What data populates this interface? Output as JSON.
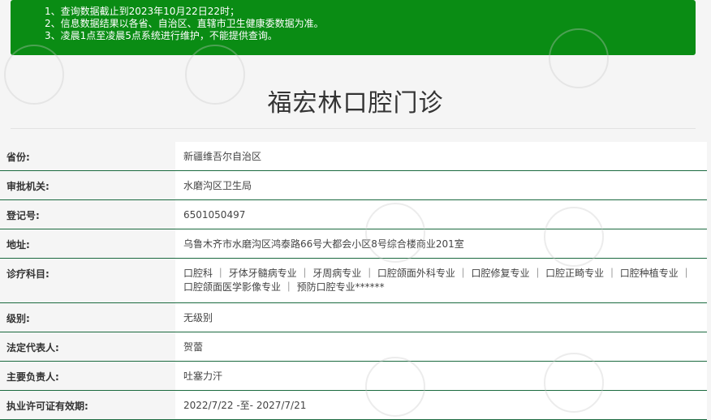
{
  "notice": {
    "lines": [
      "1、查询数据截止到2023年10月22日22时；",
      "2、信息数据结果以各省、自治区、直辖市卫生健康委数据为准。",
      "3、凌晨1点至凌晨5点系统进行维护，不能提供查询。"
    ]
  },
  "title": "福宏林口腔门诊",
  "rows": [
    {
      "label": "省份:",
      "value": "新疆维吾尔自治区"
    },
    {
      "label": "审批机关:",
      "value": "水磨沟区卫生局"
    },
    {
      "label": "登记号:",
      "value": "6501050497"
    },
    {
      "label": "地址:",
      "value": "乌鲁木齐市水磨沟区鸿泰路66号大都会小区8号综合楼商业201室"
    },
    {
      "label": "诊疗科目:",
      "value": "口腔科 ｜ 牙体牙髓病专业 ｜ 牙周病专业 ｜ 口腔颌面外科专业 ｜ 口腔修复专业 ｜ 口腔正畸专业 ｜ 口腔种植专业 ｜ 口腔颌面医学影像专业 ｜ 预防口腔专业******"
    },
    {
      "label": "级别:",
      "value": "无级别"
    },
    {
      "label": "法定代表人:",
      "value": "贺蕾"
    },
    {
      "label": "主要负责人:",
      "value": "吐塞力汗"
    },
    {
      "label": "执业许可证有效期:",
      "value": "2022/7/22 -至- 2027/7/21"
    }
  ]
}
